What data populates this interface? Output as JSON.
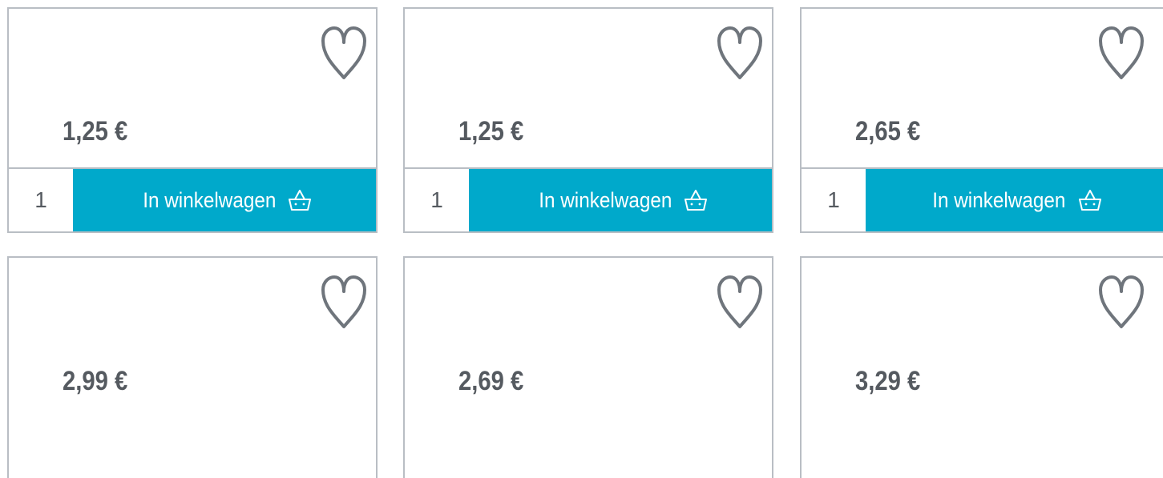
{
  "products": [
    {
      "price": "1,25 €",
      "quantity": "1",
      "cart_label": "In winkelwagen",
      "favorite_icon": "heart-outline-icon",
      "cart_icon": "basket-icon"
    },
    {
      "price": "1,25 €",
      "quantity": "1",
      "cart_label": "In winkelwagen",
      "favorite_icon": "heart-outline-icon",
      "cart_icon": "basket-icon"
    },
    {
      "price": "2,65 €",
      "quantity": "1",
      "cart_label": "In winkelwagen",
      "favorite_icon": "heart-outline-icon",
      "cart_icon": "basket-icon"
    },
    {
      "price": "2,99 €",
      "favorite_icon": "heart-outline-icon"
    },
    {
      "price": "2,69 €",
      "favorite_icon": "heart-outline-icon"
    },
    {
      "price": "3,29 €",
      "favorite_icon": "heart-outline-icon"
    }
  ],
  "colors": {
    "accent": "#00a9cb",
    "text": "#555a60",
    "border": "#b9bec4",
    "icon_stroke": "#6f757c"
  }
}
